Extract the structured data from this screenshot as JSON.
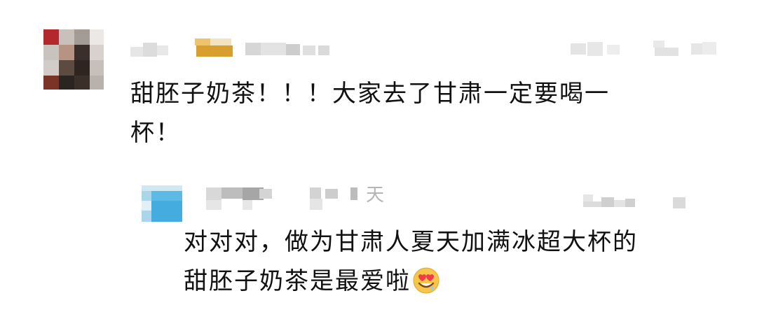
{
  "comments": [
    {
      "text_line1": "甜胚子奶茶！！！大家去了甘肃一定要喝一",
      "text_line2": "杯！"
    }
  ],
  "reply": {
    "time_suffix": "天",
    "text_line1": "对对对，做为甘肃人夏天加满冰超大杯的",
    "text_line2": "甜胚子奶茶是最爱啦",
    "emoji": "heart-eyes-drooling-emoji"
  }
}
